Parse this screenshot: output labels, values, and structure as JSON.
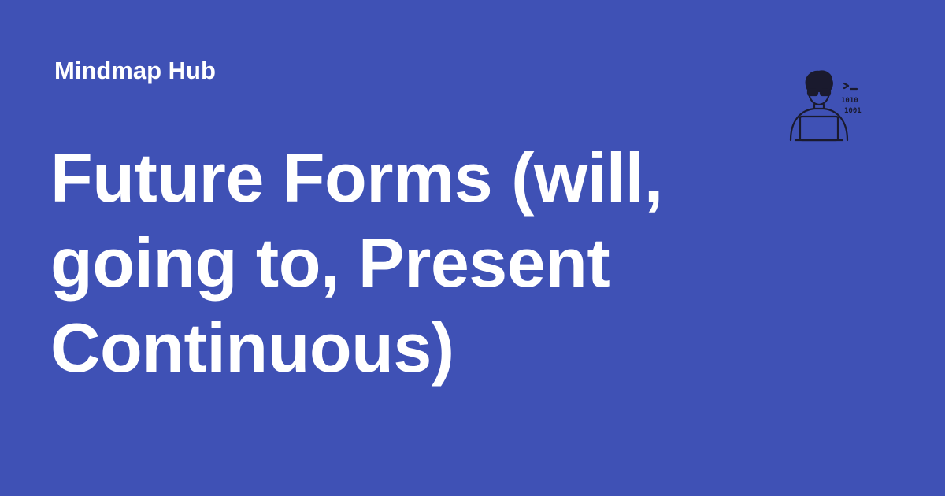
{
  "brand": {
    "name": "Mindmap Hub"
  },
  "title": {
    "text": "Future Forms (will, going to, Present Continuous)"
  },
  "icons": {
    "mascot": "coder-with-laptop-icon"
  },
  "colors": {
    "background": "#3f51b5",
    "text": "#ffffff",
    "icon_stroke": "#1a1a2e"
  }
}
